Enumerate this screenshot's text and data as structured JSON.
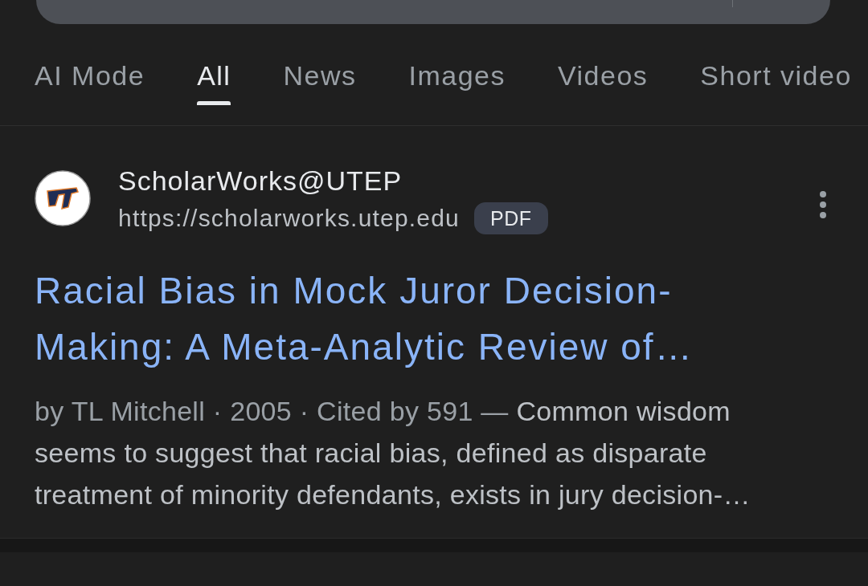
{
  "tabs": [
    {
      "label": "AI Mode",
      "selected": false
    },
    {
      "label": "All",
      "selected": true
    },
    {
      "label": "News",
      "selected": false
    },
    {
      "label": "Images",
      "selected": false
    },
    {
      "label": "Videos",
      "selected": false
    },
    {
      "label": "Short video",
      "selected": false
    }
  ],
  "result": {
    "site_name": "ScholarWorks@UTEP",
    "url": "https://scholarworks.utep.edu",
    "badge": "PDF",
    "title": "Racial Bias in Mock Juror Decision-Making: A Meta-Analytic Review of…",
    "snippet": {
      "meta": "by TL Mitchell · 2005 · Cited by 591 —",
      "text": "Common wisdom seems to suggest that racial bias, defined as disparate treatment of minority defendants, exists in jury decision-…"
    }
  }
}
